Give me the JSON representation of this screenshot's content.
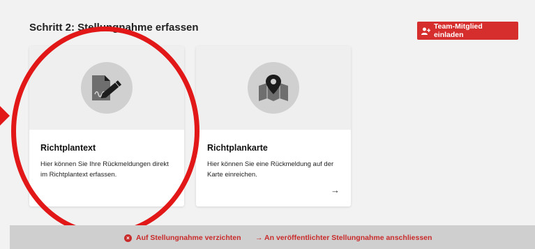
{
  "header": {
    "title": "Schritt 2: Stellungnahme erfassen",
    "invite_button": {
      "label": "Team-Mitglied einladen",
      "icon": "user-plus-icon"
    }
  },
  "cards": [
    {
      "title": "Richtplantext",
      "description": "Hier können Sie Ihre Rückmeldungen direkt im Richtplantext erfassen.",
      "icon": "document-edit-icon"
    },
    {
      "title": "Richtplankarte",
      "description": "Hier können Sie eine Rückmeldung auf der Karte einreichen.",
      "icon": "map-pin-icon",
      "arrow": "→"
    }
  ],
  "footer": {
    "waive_label": "Auf Stellungnahme verzichten",
    "join_label": "→ An veröffentlichter Stellungnahme anschliessen"
  },
  "colors": {
    "accent": "#d62d2d",
    "annotation": "#e21818",
    "footer_bg": "#cfcfcf"
  }
}
